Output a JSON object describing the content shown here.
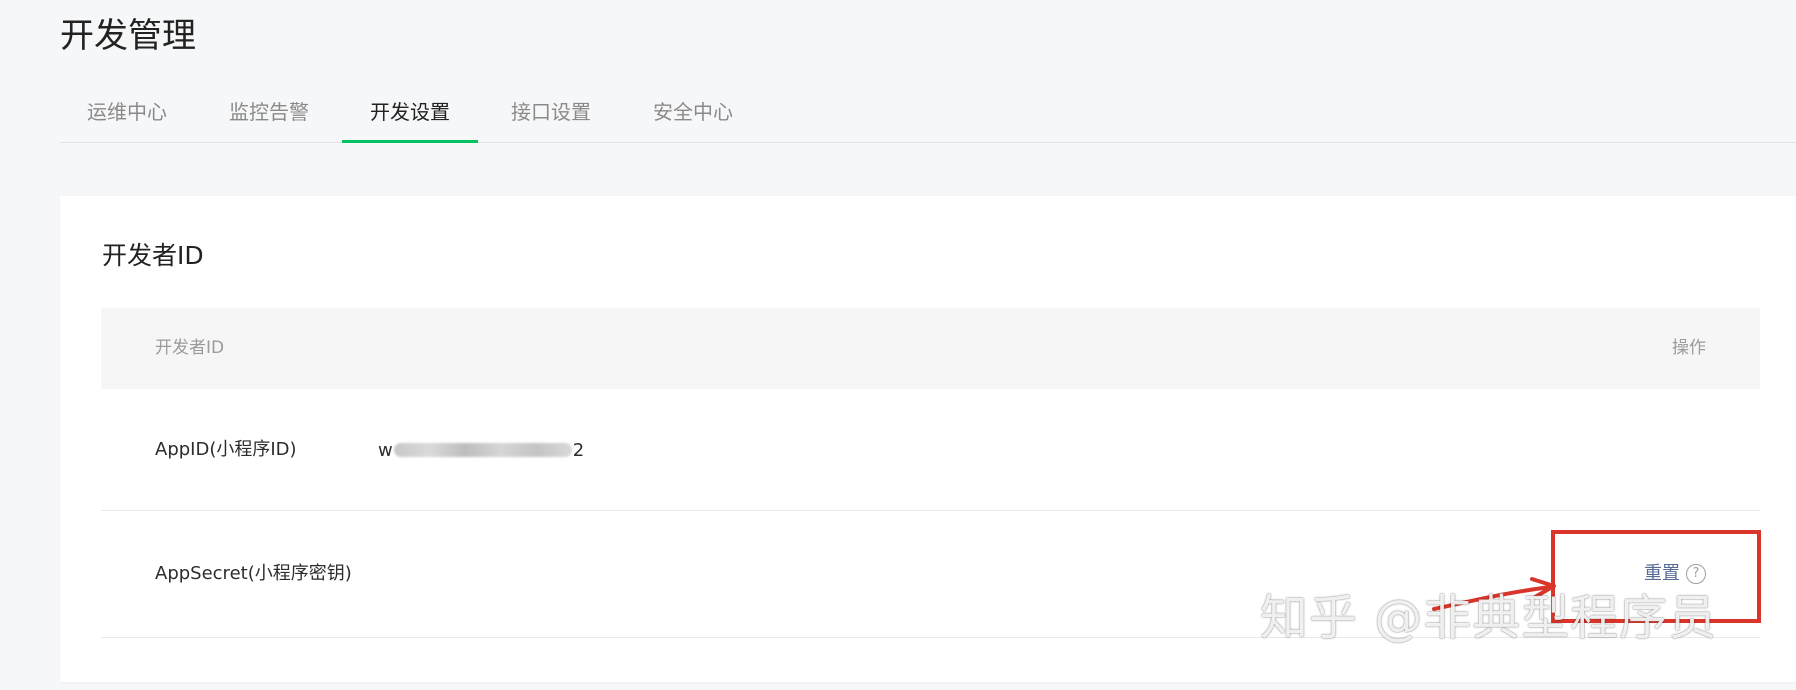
{
  "page": {
    "title": "开发管理"
  },
  "tabs": [
    {
      "label": "运维中心"
    },
    {
      "label": "监控告警"
    },
    {
      "label": "开发设置",
      "active": true
    },
    {
      "label": "接口设置"
    },
    {
      "label": "安全中心"
    }
  ],
  "developer_id": {
    "section_title": "开发者ID",
    "table": {
      "headers": {
        "id": "开发者ID",
        "action": "操作"
      },
      "rows": [
        {
          "label": "AppID(小程序ID)",
          "value_prefix": "w",
          "value_suffix": "2"
        },
        {
          "label": "AppSecret(小程序密钥)",
          "action_label": "重置"
        }
      ]
    }
  },
  "icons": {
    "help": "question-circle-icon"
  },
  "colors": {
    "active_tab_underline": "#07c160",
    "link": "#576b95",
    "annotation": "#d9352a"
  },
  "watermark": "知乎 @非典型程序员"
}
